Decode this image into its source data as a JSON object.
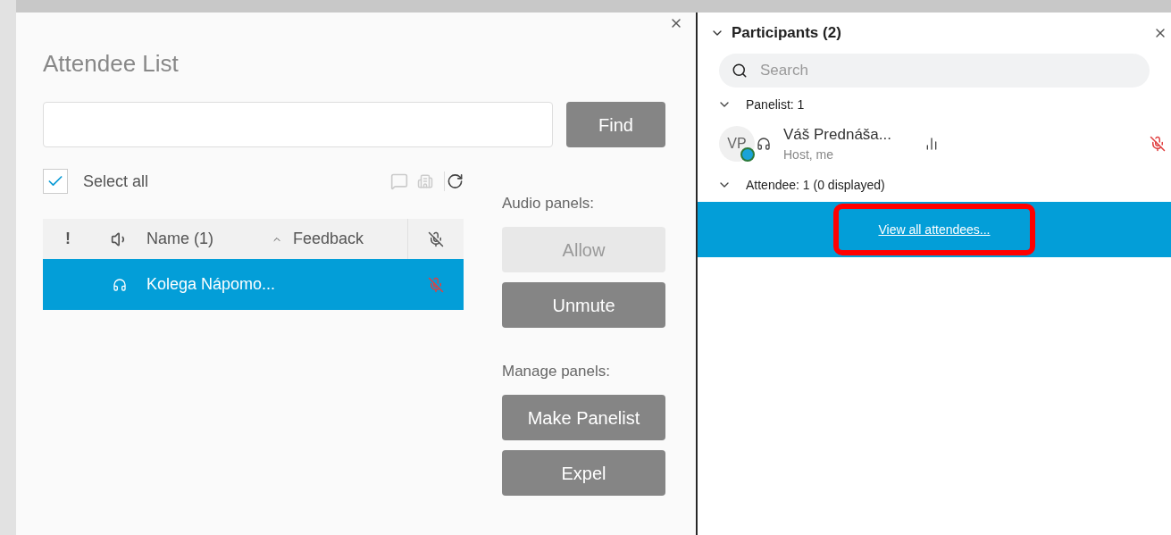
{
  "dialog": {
    "title": "Attendee List",
    "find_button": "Find",
    "select_all": {
      "label": "Select all",
      "checked": true
    },
    "table": {
      "columns": [
        {
          "kind": "text",
          "label": "!"
        },
        {
          "kind": "speaker"
        },
        {
          "kind": "text",
          "label": "Name (1)"
        },
        {
          "kind": "sort",
          "label": "Feedback"
        },
        {
          "kind": "mic"
        }
      ],
      "rows": [
        {
          "name": "Kolega Nápomo...",
          "selected": true,
          "muted": true
        }
      ]
    },
    "sections": [
      {
        "label": "Audio panels:",
        "buttons": [
          {
            "label": "Allow",
            "disabled": true
          },
          {
            "label": "Unmute",
            "disabled": false
          }
        ]
      },
      {
        "label": "Manage panels:",
        "buttons": [
          {
            "label": "Make Panelist",
            "disabled": false
          },
          {
            "label": "Expel",
            "disabled": false
          }
        ]
      }
    ]
  },
  "participants": {
    "title": "Participants (2)",
    "search": {
      "placeholder": "Search"
    },
    "groups": [
      {
        "label": "Panelist: 1",
        "expanded": true,
        "members": [
          {
            "initials": "VP",
            "name": "Váš Prednáša...",
            "role": "Host, me",
            "muted": true
          }
        ]
      },
      {
        "label": "Attendee: 1 (0 displayed)",
        "expanded": true
      }
    ],
    "view_all": {
      "label": "View all attendees...",
      "highlighted": true
    }
  }
}
